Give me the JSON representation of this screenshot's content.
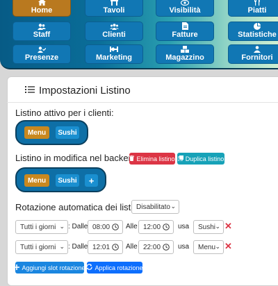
{
  "nav": {
    "items": [
      {
        "label": "Home",
        "icon": "home-icon"
      },
      {
        "label": "Tavoli",
        "icon": "table-icon"
      },
      {
        "label": "Visibilità",
        "icon": "eye-icon"
      },
      {
        "label": "Piatti",
        "icon": "utensils-icon"
      },
      {
        "label": "Staff",
        "icon": "users-icon"
      },
      {
        "label": "Clienti",
        "icon": "user-group-icon"
      },
      {
        "label": "Fatture",
        "icon": "file-invoice-icon"
      },
      {
        "label": "Statistiche",
        "icon": "pie-chart-icon"
      },
      {
        "label": "Presenze",
        "icon": "user-check-icon"
      },
      {
        "label": "Marketing",
        "icon": "marketing-icon"
      },
      {
        "label": "Magazzino",
        "icon": "boxes-icon"
      },
      {
        "label": "Fornitori",
        "icon": "supplier-icon"
      }
    ],
    "active": "Home",
    "active_color": "#b9791f",
    "button_color": "#1177b4"
  },
  "settings": {
    "title": "Impostazioni Listino",
    "active_label": "Listino attivo per i clienti:",
    "active_menus": [
      "Menu",
      "Sushi"
    ],
    "edit_label": "Listino in modifica nel backend:",
    "delete_button": "Elimina listino",
    "duplicate_button": "Duplica listino",
    "edit_menus": [
      "Menu",
      "Sushi"
    ],
    "add_button": "+",
    "rotation_label": "Rotazione automatica dei listini:",
    "rotation_value": "Disabilitato",
    "rows": [
      {
        "days": "Tutti i giorni",
        "from_label": ": Dalle",
        "from": "08:00",
        "to_label": "Alle",
        "to": "12:00",
        "use_label": "usa",
        "menu": "Sushi"
      },
      {
        "days": "Tutti i giorni",
        "from_label": ": Dalle",
        "from": "12:01",
        "to_label": "Alle",
        "to": "22:00",
        "use_label": "usa",
        "menu": "Menu"
      }
    ],
    "add_slot_button": "Aggiungi slot rotazione",
    "apply_button": "Applica rotazione"
  }
}
